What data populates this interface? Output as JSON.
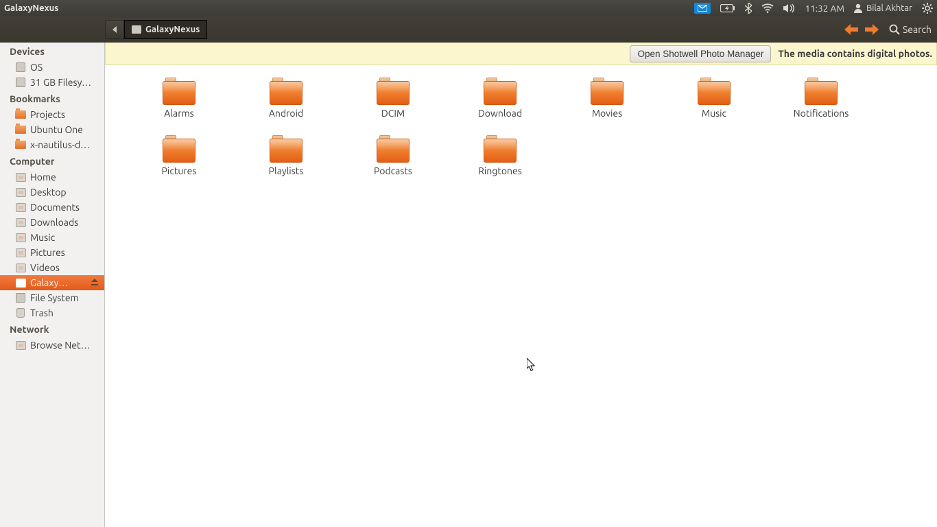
{
  "panel": {
    "app_title": "GalaxyNexus",
    "time": "11:32 AM",
    "user": "Bilal Akhtar"
  },
  "toolbar": {
    "location": "GalaxyNexus",
    "search_label": "Search"
  },
  "infobar": {
    "button": "Open Shotwell Photo Manager",
    "message": "The media contains digital photos."
  },
  "sidebar": {
    "sections": [
      {
        "title": "Devices",
        "items": [
          {
            "label": "OS",
            "icon": "disk"
          },
          {
            "label": "31 GB Filesy…",
            "icon": "disk"
          }
        ]
      },
      {
        "title": "Bookmarks",
        "items": [
          {
            "label": "Projects",
            "icon": "folder"
          },
          {
            "label": "Ubuntu One",
            "icon": "folder"
          },
          {
            "label": "x-nautilus-d…",
            "icon": "folder"
          }
        ]
      },
      {
        "title": "Computer",
        "items": [
          {
            "label": "Home",
            "icon": "special"
          },
          {
            "label": "Desktop",
            "icon": "special"
          },
          {
            "label": "Documents",
            "icon": "special"
          },
          {
            "label": "Downloads",
            "icon": "special"
          },
          {
            "label": "Music",
            "icon": "special"
          },
          {
            "label": "Pictures",
            "icon": "special"
          },
          {
            "label": "Videos",
            "icon": "special"
          },
          {
            "label": "Galaxy…",
            "icon": "device",
            "active": true,
            "eject": true
          },
          {
            "label": "File System",
            "icon": "disk"
          },
          {
            "label": "Trash",
            "icon": "trash"
          }
        ]
      },
      {
        "title": "Network",
        "items": [
          {
            "label": "Browse Net…",
            "icon": "special"
          }
        ]
      }
    ]
  },
  "folders": [
    "Alarms",
    "Android",
    "DCIM",
    "Download",
    "Movies",
    "Music",
    "Notifications",
    "Pictures",
    "Playlists",
    "Podcasts",
    "Ringtones"
  ]
}
